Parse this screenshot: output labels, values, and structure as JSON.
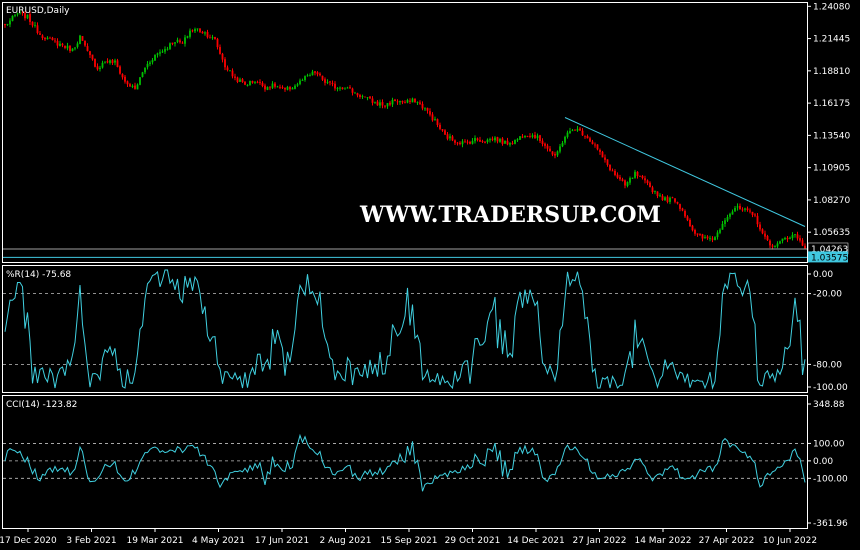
{
  "chart_data": [
    {
      "type": "candlestick",
      "title": "EURUSD,Daily",
      "watermark": "WWW.TRADERSUP.COM",
      "colors": {
        "bull": "#00c000",
        "bear": "#ff0000",
        "trendline": "#40c8e0",
        "background": "#000000",
        "frame": "#ffffff"
      },
      "y_ticks": [
        "1.24080",
        "1.21445",
        "1.18810",
        "1.16175",
        "1.13540",
        "1.10905",
        "1.08270",
        "1.05635"
      ],
      "ylim": [
        1.032,
        1.2435
      ],
      "price_labels": [
        "1.04263",
        "1.03575"
      ],
      "horizontal_levels": [
        1.04263,
        1.03575
      ],
      "x_ticks": [
        "17 Dec 2020",
        "3 Feb 2021",
        "19 Mar 2021",
        "4 May 2021",
        "17 Jun 2021",
        "2 Aug 2021",
        "15 Sep 2021",
        "29 Oct 2021",
        "14 Dec 2021",
        "27 Jan 2022",
        "14 Mar 2022",
        "27 Apr 2022",
        "10 Jun 2022"
      ],
      "close_path": [
        [
          0,
          1.225
        ],
        [
          5,
          1.235
        ],
        [
          9,
          1.232
        ],
        [
          14,
          1.218
        ],
        [
          19,
          1.212
        ],
        [
          23,
          1.209
        ],
        [
          27,
          1.205
        ],
        [
          30,
          1.216
        ],
        [
          33,
          1.203
        ],
        [
          37,
          1.19
        ],
        [
          40,
          1.196
        ],
        [
          44,
          1.195
        ],
        [
          48,
          1.179
        ],
        [
          52,
          1.173
        ],
        [
          56,
          1.191
        ],
        [
          60,
          1.201
        ],
        [
          64,
          1.206
        ],
        [
          68,
          1.213
        ],
        [
          71,
          1.21
        ],
        [
          74,
          1.221
        ],
        [
          77,
          1.222
        ],
        [
          80,
          1.219
        ],
        [
          84,
          1.213
        ],
        [
          88,
          1.192
        ],
        [
          92,
          1.182
        ],
        [
          96,
          1.177
        ],
        [
          100,
          1.18
        ],
        [
          104,
          1.175
        ],
        [
          108,
          1.176
        ],
        [
          112,
          1.172
        ],
        [
          116,
          1.176
        ],
        [
          120,
          1.182
        ],
        [
          124,
          1.187
        ],
        [
          128,
          1.179
        ],
        [
          132,
          1.175
        ],
        [
          136,
          1.175
        ],
        [
          140,
          1.17
        ],
        [
          144,
          1.166
        ],
        [
          148,
          1.162
        ],
        [
          152,
          1.16
        ],
        [
          156,
          1.164
        ],
        [
          160,
          1.162
        ],
        [
          164,
          1.164
        ],
        [
          168,
          1.157
        ],
        [
          172,
          1.147
        ],
        [
          176,
          1.135
        ],
        [
          180,
          1.131
        ],
        [
          184,
          1.129
        ],
        [
          188,
          1.132
        ],
        [
          192,
          1.131
        ],
        [
          196,
          1.133
        ],
        [
          200,
          1.129
        ],
        [
          204,
          1.131
        ],
        [
          208,
          1.137
        ],
        [
          212,
          1.135
        ],
        [
          216,
          1.128
        ],
        [
          220,
          1.117
        ],
        [
          224,
          1.135
        ],
        [
          228,
          1.141
        ],
        [
          232,
          1.136
        ],
        [
          236,
          1.127
        ],
        [
          240,
          1.114
        ],
        [
          244,
          1.103
        ],
        [
          248,
          1.094
        ],
        [
          252,
          1.104
        ],
        [
          256,
          1.097
        ],
        [
          260,
          1.089
        ],
        [
          264,
          1.083
        ],
        [
          268,
          1.083
        ],
        [
          272,
          1.071
        ],
        [
          276,
          1.054
        ],
        [
          280,
          1.051
        ],
        [
          284,
          1.052
        ],
        [
          288,
          1.068
        ],
        [
          292,
          1.076
        ],
        [
          296,
          1.074
        ],
        [
          300,
          1.069
        ],
        [
          304,
          1.051
        ],
        [
          308,
          1.044
        ],
        [
          312,
          1.052
        ],
        [
          316,
          1.054
        ],
        [
          320,
          1.044
        ]
      ],
      "trendline": [
        [
          224,
          1.15
        ],
        [
          320,
          1.061
        ]
      ]
    },
    {
      "type": "line",
      "label": "%R(14) -75.68",
      "y_ticks": [
        "0.00",
        "-20.00",
        "-80.00",
        "-100.00"
      ],
      "ylim": [
        -100,
        0
      ],
      "levels": [
        -20,
        -80
      ],
      "color": "#40d0e0",
      "x_range": [
        0,
        320
      ]
    },
    {
      "type": "line",
      "label": "CCI(14) -123.82",
      "y_ticks": [
        "348.88",
        "100.00",
        "0.00",
        "-100.00",
        "-361.96"
      ],
      "ylim": [
        -361.96,
        348.88
      ],
      "levels": [
        100,
        0,
        -100
      ],
      "color": "#40d0e0",
      "x_range": [
        0,
        320
      ]
    }
  ]
}
